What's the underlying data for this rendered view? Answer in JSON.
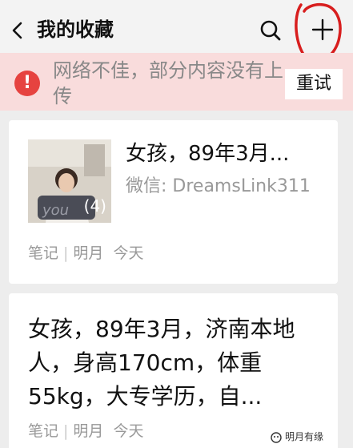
{
  "header": {
    "title": "我的收藏",
    "back_icon": "chevron-left-icon",
    "search_icon": "search-icon",
    "add_icon": "plus-icon"
  },
  "banner": {
    "message": "网络不佳，部分内容没有上传",
    "retry_label": "重试",
    "icon": "alert-icon",
    "color": "#e64340"
  },
  "items": [
    {
      "title": "女孩，89年3月...",
      "subtitle": "微信: DreamsLink311",
      "image_count": "(4)",
      "type": "笔记",
      "author": "明月",
      "date": "今天"
    },
    {
      "text": "女孩，89年3月，济南本地人，身高170cm，体重55kg，大专学历，自...",
      "type": "笔记",
      "author": "明月",
      "date": "今天"
    }
  ],
  "watermark": {
    "text": "明月有缘"
  },
  "colors": {
    "accent_red": "#e64340",
    "banner_bg": "#f9dcdc",
    "annotation_red": "#d81e1e"
  }
}
